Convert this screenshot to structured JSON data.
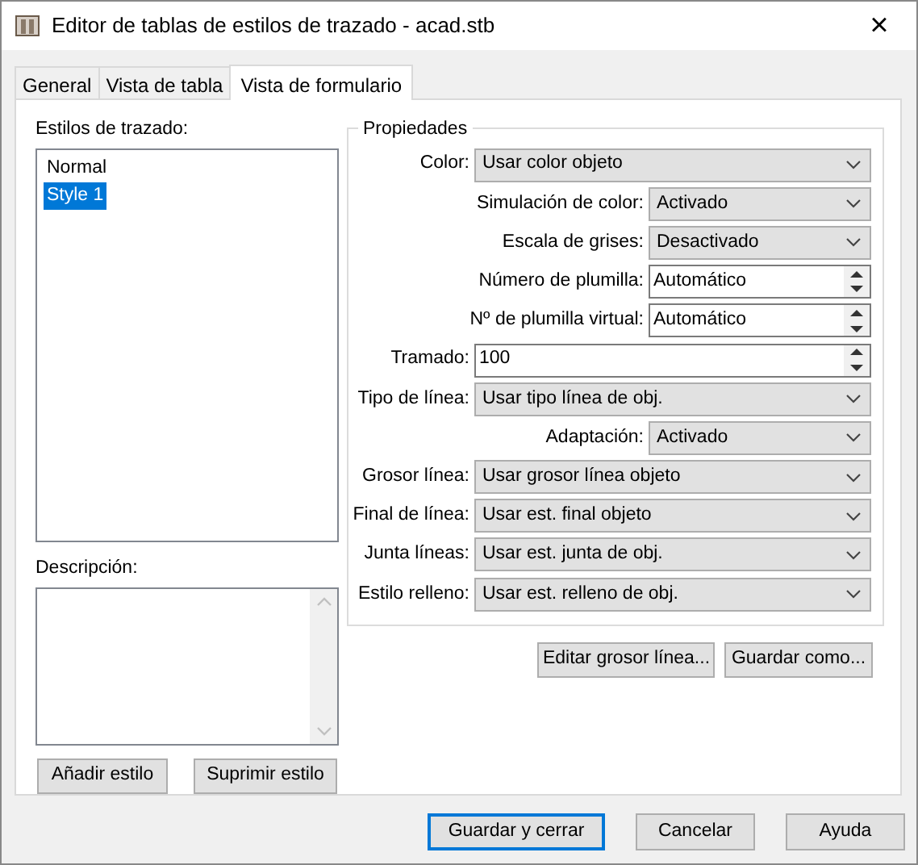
{
  "window": {
    "title": "Editor de tablas de estilos de trazado - acad.stb",
    "close": "×"
  },
  "tabs": [
    {
      "label": "General",
      "selected": false
    },
    {
      "label": "Vista de tabla",
      "selected": false
    },
    {
      "label": "Vista de formulario",
      "selected": true
    }
  ],
  "styles": {
    "label": "Estilos de trazado:",
    "items": [
      {
        "label": "Normal",
        "selected": false
      },
      {
        "label": "Style 1",
        "selected": true
      }
    ]
  },
  "description": {
    "label": "Descripción:"
  },
  "style_buttons": [
    "Añadir estilo",
    "Suprimir estilo"
  ],
  "properties": {
    "title": "Propiedades",
    "rows": [
      {
        "kind": "dropdown",
        "label": "Color:",
        "value": "Usar color objeto",
        "nested": false
      },
      {
        "kind": "dropdown",
        "label": "Simulación de color:",
        "value": "Activado",
        "nested": true
      },
      {
        "kind": "dropdown",
        "label": "Escala de grises:",
        "value": "Desactivado",
        "nested": true
      },
      {
        "kind": "spinner",
        "label": "Número de plumilla:",
        "value": "Automático",
        "nested": true
      },
      {
        "kind": "spinner",
        "label": "Nº de plumilla virtual:",
        "value": "Automático",
        "nested": true
      },
      {
        "kind": "spinner",
        "label": "Tramado:",
        "value": "100",
        "nested": false
      },
      {
        "kind": "dropdown",
        "label": "Tipo de línea:",
        "value": "Usar tipo línea de obj.",
        "nested": false
      },
      {
        "kind": "dropdown",
        "label": "Adaptación:",
        "value": "Activado",
        "nested": true
      },
      {
        "kind": "dropdown",
        "label": "Grosor línea:",
        "value": "Usar grosor línea objeto",
        "nested": false
      },
      {
        "kind": "dropdown",
        "label": "Final de línea:",
        "value": "Usar est. final objeto",
        "nested": false
      },
      {
        "kind": "dropdown",
        "label": "Junta líneas:",
        "value": "Usar est. junta de obj.",
        "nested": false
      },
      {
        "kind": "dropdown",
        "label": "Estilo relleno:",
        "value": "Usar est. relleno de obj.",
        "nested": false
      }
    ]
  },
  "property_buttons": [
    "Editar grosor línea...",
    "Guardar como..."
  ],
  "footer_buttons": [
    {
      "label": "Guardar y cerrar",
      "default": true
    },
    {
      "label": "Cancelar",
      "default": false
    },
    {
      "label": "Ayuda",
      "default": false
    }
  ]
}
